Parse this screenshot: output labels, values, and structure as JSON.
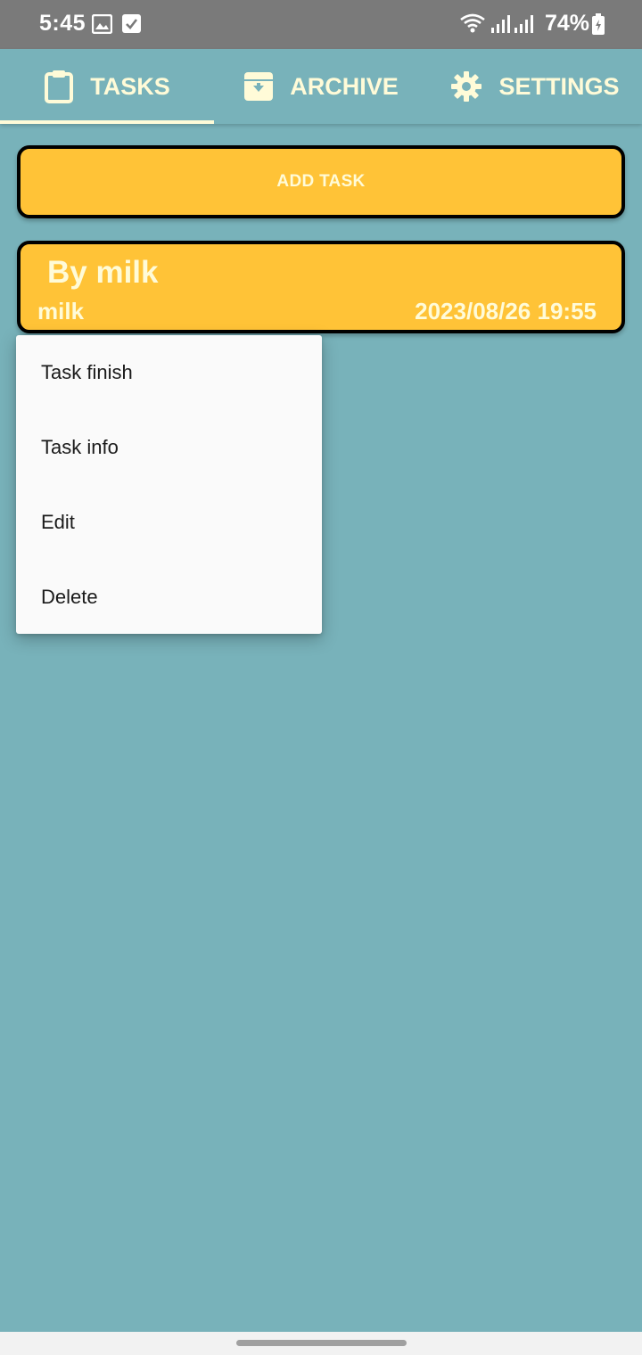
{
  "status_bar": {
    "time": "5:45",
    "battery": "74%",
    "icons": [
      "image-icon",
      "checkbox-icon",
      "wifi-icon",
      "signal-icon",
      "signal-icon",
      "battery-icon"
    ]
  },
  "tabs": [
    {
      "label": "TASKS",
      "icon": "clipboard-icon",
      "selected": true
    },
    {
      "label": "ARCHIVE",
      "icon": "archive-icon",
      "selected": false
    },
    {
      "label": "SETTINGS",
      "icon": "gear-icon",
      "selected": false
    }
  ],
  "add_task": {
    "label": "ADD TASK"
  },
  "task": {
    "title": "By milk",
    "note": "milk",
    "datetime": "2023/08/26 19:55"
  },
  "context_menu": {
    "items": [
      "Task finish",
      "Task info",
      "Edit",
      "Delete"
    ]
  },
  "colors": {
    "background": "#78b2ba",
    "accent": "#ffc337",
    "text_light": "#fffbd8",
    "status_bar": "#7a7a7a"
  }
}
